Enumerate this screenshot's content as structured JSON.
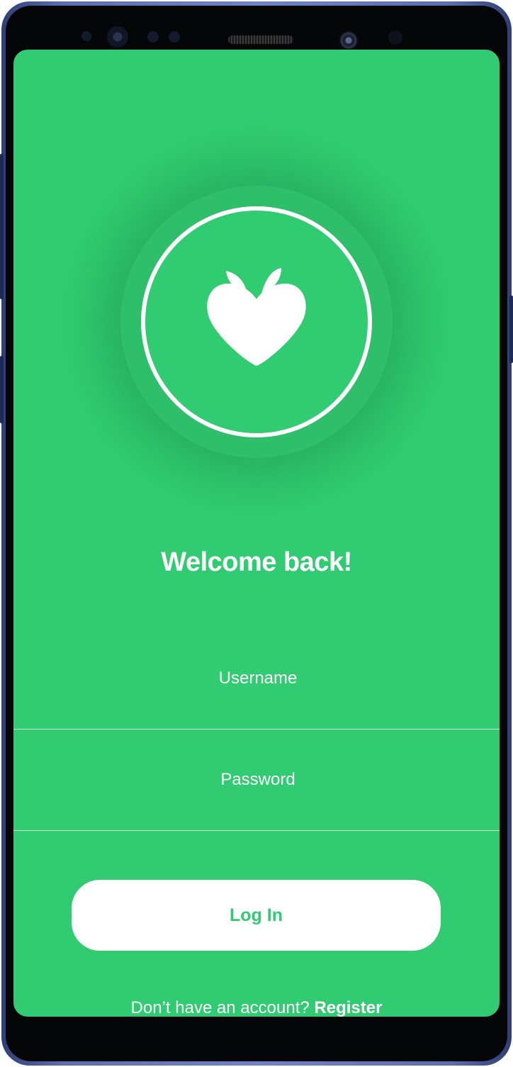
{
  "app": {
    "brand_color": "#31cc71",
    "logo_icon": "heart-apple-icon"
  },
  "login": {
    "title": "Welcome back!",
    "username_placeholder": "Username",
    "username_value": "",
    "password_placeholder": "Password",
    "password_value": "",
    "login_button_label": "Log In",
    "register_prompt": "Don’t have an account? ",
    "register_link": "Register"
  }
}
